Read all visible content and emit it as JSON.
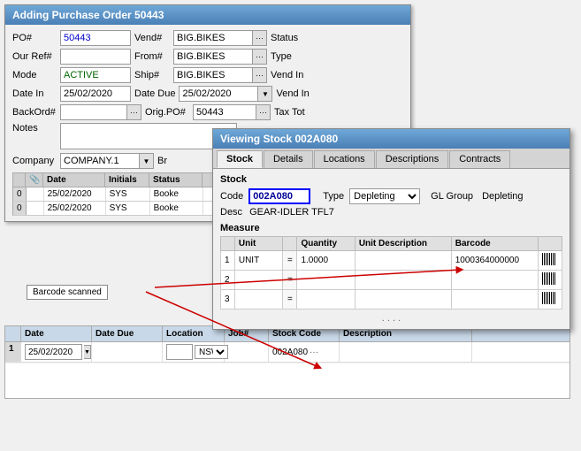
{
  "mainWindow": {
    "title": "Adding Purchase Order 50443",
    "fields": {
      "po_label": "PO#",
      "po_value": "50443",
      "vend_label": "Vend#",
      "vend_value": "BIG.BIKES",
      "status_label": "Status",
      "ourref_label": "Our Ref#",
      "from_label": "From#",
      "from_value": "BIG.BIKES",
      "type_label": "Type",
      "mode_label": "Mode",
      "mode_value": "ACTIVE",
      "ship_label": "Ship#",
      "ship_value": "BIG.BIKES",
      "vendin_label": "Vend In",
      "datein_label": "Date In",
      "datein_value": "25/02/2020",
      "datedue_label": "Date Due",
      "datedue_value": "25/02/2020",
      "vendin2_label": "Vend In",
      "backord_label": "BackOrd#",
      "origpo_label": "Orig.PO#",
      "origpo_value": "50443",
      "taxtot_label": "Tax Tot",
      "notes_label": "Notes",
      "company_label": "Company",
      "company_value": "COMPANY.1",
      "br_label": "Br"
    },
    "grid": {
      "columns": [
        "",
        "",
        "Date",
        "Initials",
        "Status"
      ],
      "rows": [
        {
          "num": "0",
          "date": "25/02/2020",
          "initials": "SYS",
          "status": "Booke"
        },
        {
          "num": "0",
          "date": "25/02/2020",
          "initials": "SYS",
          "status": "Booke"
        }
      ]
    }
  },
  "stockWindow": {
    "title": "Viewing Stock 002A080",
    "tabs": [
      "Stock",
      "Details",
      "Locations",
      "Descriptions",
      "Contracts"
    ],
    "activeTab": "Stock",
    "section_title": "Stock",
    "code_label": "Code",
    "code_value": "002A080",
    "type_label": "Type",
    "type_value": "Depleting",
    "glgroup_label": "GL Group",
    "glgroup_value": "Depleting",
    "desc_label": "Desc",
    "desc_value": "GEAR-IDLER TFL7",
    "measure_title": "Measure",
    "measure_columns": [
      "Unit",
      "Quantity",
      "Unit Description",
      "Barcode"
    ],
    "measure_rows": [
      {
        "num": "1",
        "unit": "UNIT",
        "eq": "=",
        "qty": "1.0000",
        "unit_desc": "",
        "barcode": "1000364000000"
      },
      {
        "num": "2",
        "unit": "",
        "eq": "=",
        "qty": "",
        "unit_desc": "",
        "barcode": ""
      },
      {
        "num": "3",
        "unit": "",
        "eq": "=",
        "qty": "",
        "unit_desc": "",
        "barcode": ""
      }
    ]
  },
  "barcodeCallout": "Barcode scanned",
  "bottomGrid": {
    "columns": [
      "",
      "Date",
      "Date Due",
      "Location",
      "Job#",
      "Stock Code",
      "Description"
    ],
    "rows": [
      {
        "num": "1",
        "date": "25/02/2020",
        "datedue": "",
        "location": "NSW",
        "job": "",
        "stockcode": "002A080",
        "description": ""
      }
    ]
  }
}
